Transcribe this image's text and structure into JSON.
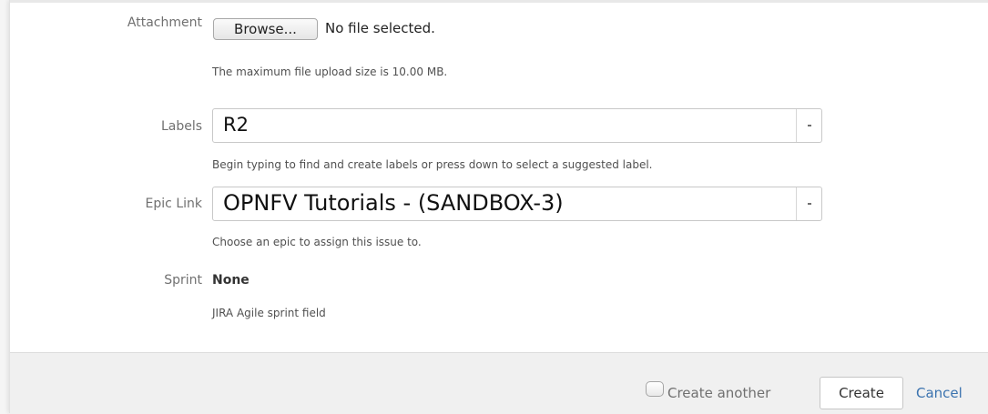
{
  "attachment": {
    "label": "Attachment",
    "browse_label": "Browse...",
    "status_text": "No file selected.",
    "help": "The maximum file upload size is 10.00 MB."
  },
  "labels": {
    "label": "Labels",
    "value": "R2",
    "help": "Begin typing to find and create labels or press down to select a suggested label."
  },
  "epic_link": {
    "label": "Epic Link",
    "value": "OPNFV Tutorials - (SANDBOX-3)",
    "help": "Choose an epic to assign this issue to."
  },
  "sprint": {
    "label": "Sprint",
    "value": "None",
    "help": "JIRA Agile sprint field"
  },
  "footer": {
    "create_another_label": "Create another",
    "create_label": "Create",
    "cancel_label": "Cancel"
  },
  "colors": {
    "link": "#3b73af",
    "footer_bg": "#f0f0f0",
    "label_text": "#707070"
  }
}
